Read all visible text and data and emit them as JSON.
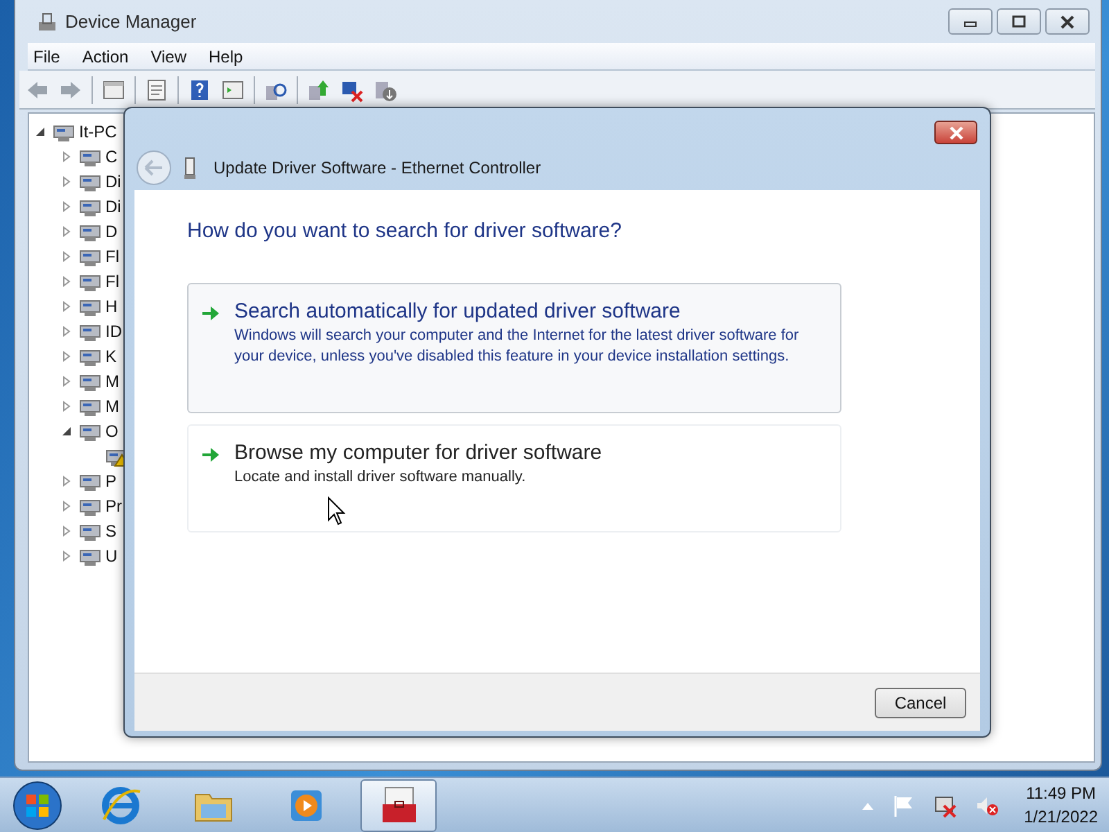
{
  "window": {
    "title": "Device Manager"
  },
  "menu": [
    "File",
    "Action",
    "View",
    "Help"
  ],
  "tree": {
    "label": "It-PC",
    "expanded": true,
    "children": [
      {
        "label": "C",
        "expanded": false
      },
      {
        "label": "Di",
        "expanded": false
      },
      {
        "label": "Di",
        "expanded": false
      },
      {
        "label": "D",
        "expanded": false
      },
      {
        "label": "Fl",
        "expanded": false
      },
      {
        "label": "Fl",
        "expanded": false
      },
      {
        "label": "H",
        "expanded": false
      },
      {
        "label": "ID",
        "expanded": false
      },
      {
        "label": "K",
        "expanded": false
      },
      {
        "label": "M",
        "expanded": false
      },
      {
        "label": "M",
        "expanded": false
      },
      {
        "label": "O",
        "expanded": true,
        "children": [
          {
            "warning": true
          }
        ]
      },
      {
        "label": "P",
        "expanded": false
      },
      {
        "label": "Pr",
        "expanded": false
      },
      {
        "label": "S",
        "expanded": false
      },
      {
        "label": "U",
        "expanded": false
      }
    ]
  },
  "dialog": {
    "title": "Update Driver Software - Ethernet Controller",
    "heading": "How do you want to search for driver software?",
    "options": [
      {
        "title": "Search automatically for updated driver software",
        "description": "Windows will search your computer and the Internet for the latest driver software for your device, unless you've disabled this feature in your device installation settings.",
        "highlighted": true
      },
      {
        "title": "Browse my computer for driver software",
        "description": "Locate and install driver software manually.",
        "highlighted": false
      }
    ],
    "buttons": [
      "Cancel"
    ]
  },
  "taskbar": {
    "apps": [
      {
        "kind": "browser",
        "selected": false
      },
      {
        "kind": "folder",
        "selected": false
      },
      {
        "kind": "media",
        "selected": false
      },
      {
        "kind": "toolbox",
        "selected": true
      }
    ],
    "time": "11:49 PM",
    "date": "1/21/2022"
  }
}
